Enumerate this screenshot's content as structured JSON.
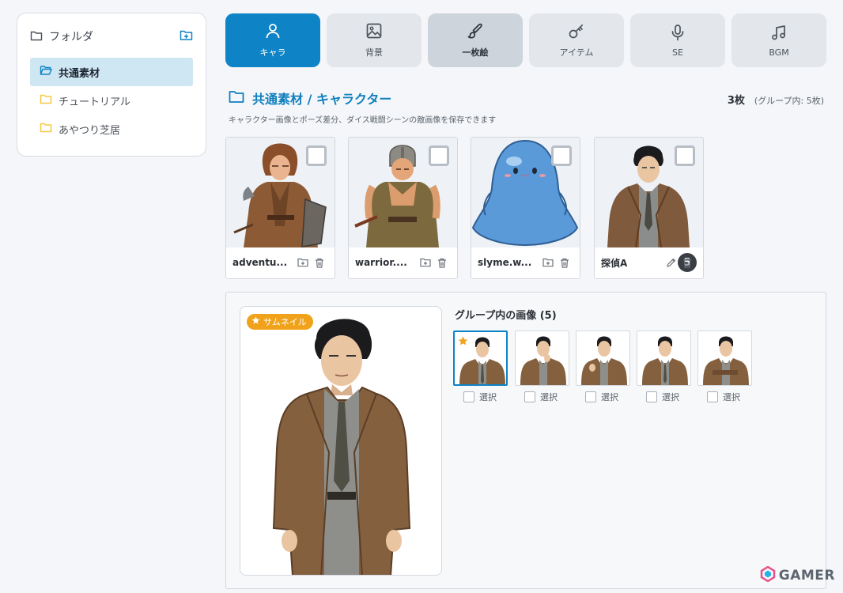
{
  "sidebar": {
    "title": "フォルダ",
    "items": [
      {
        "label": "共通素材",
        "active": true
      },
      {
        "label": "チュートリアル",
        "active": false
      },
      {
        "label": "あやつり芝居",
        "active": false
      }
    ]
  },
  "tabs": [
    {
      "label": "キャラ",
      "icon": "person-icon",
      "state": "active"
    },
    {
      "label": "背景",
      "icon": "image-icon",
      "state": "normal"
    },
    {
      "label": "一枚絵",
      "icon": "brush-icon",
      "state": "hover"
    },
    {
      "label": "アイテム",
      "icon": "key-icon",
      "state": "normal"
    },
    {
      "label": "SE",
      "icon": "microphone-icon",
      "state": "normal"
    },
    {
      "label": "BGM",
      "icon": "music-icon",
      "state": "normal"
    }
  ],
  "main": {
    "heading": "共通素材 / キャラクター",
    "count": "3枚",
    "group_count": "(グループ内: 5枚)",
    "description": "キャラクター画像とポーズ差分、ダイス戦闘シーンの敵画像を保存できます"
  },
  "cards": [
    {
      "name": "adventu...",
      "badge": null
    },
    {
      "name": "warrior....",
      "badge": null
    },
    {
      "name": "slyme.w...",
      "badge": null
    },
    {
      "name": "探偵A",
      "badge": "5"
    }
  ],
  "detail": {
    "thumbnail_tag": "サムネイル",
    "group_title": "グループ内の画像 (5)",
    "select_label": "選択",
    "group_images": 5
  },
  "colors": {
    "accent": "#0e83c6",
    "heading": "#0e7fbf",
    "folder_yellow": "#f5c842",
    "thumbnail_tag": "#f0a21b",
    "active_item_bg": "#cfe6f3"
  },
  "watermark": "GAMER"
}
